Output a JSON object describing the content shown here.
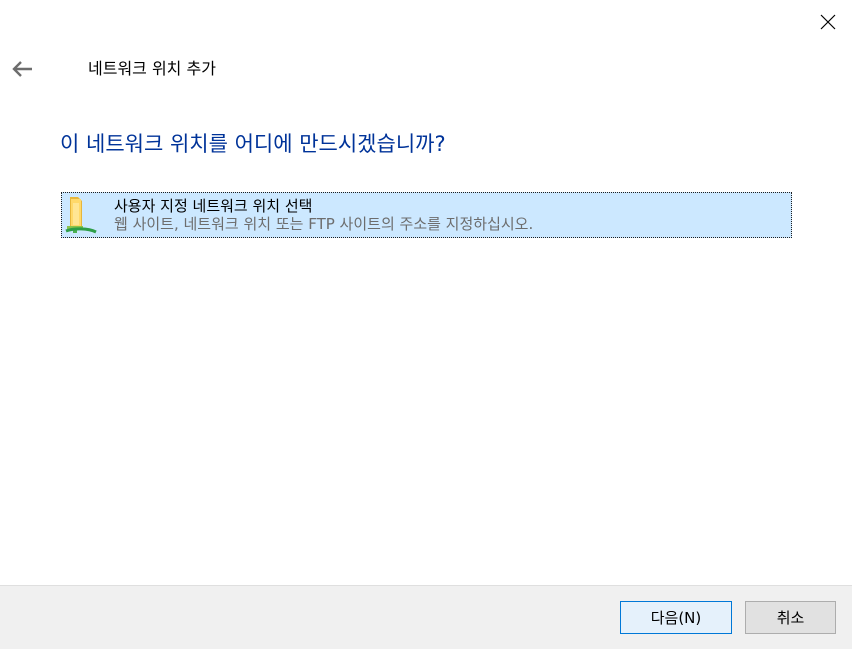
{
  "window": {
    "title": "네트워크 위치 추가"
  },
  "icons": {
    "close": "close-icon",
    "back": "back-arrow-icon",
    "option": "network-folder-icon"
  },
  "main": {
    "heading": "이 네트워크 위치를 어디에 만드시겠습니까?",
    "options": [
      {
        "title": "사용자 지정 네트워크 위치 선택",
        "description": "웹 사이트, 네트워크 위치 또는 FTP 사이트의 주소를 지정하십시오.",
        "selected": true
      }
    ]
  },
  "footer": {
    "next_label": "다음(N)",
    "cancel_label": "취소"
  },
  "colors": {
    "heading": "#003399",
    "selection": "#cce8ff",
    "primary_button_border": "#0078d7",
    "footer_background": "#f0f0f0"
  }
}
